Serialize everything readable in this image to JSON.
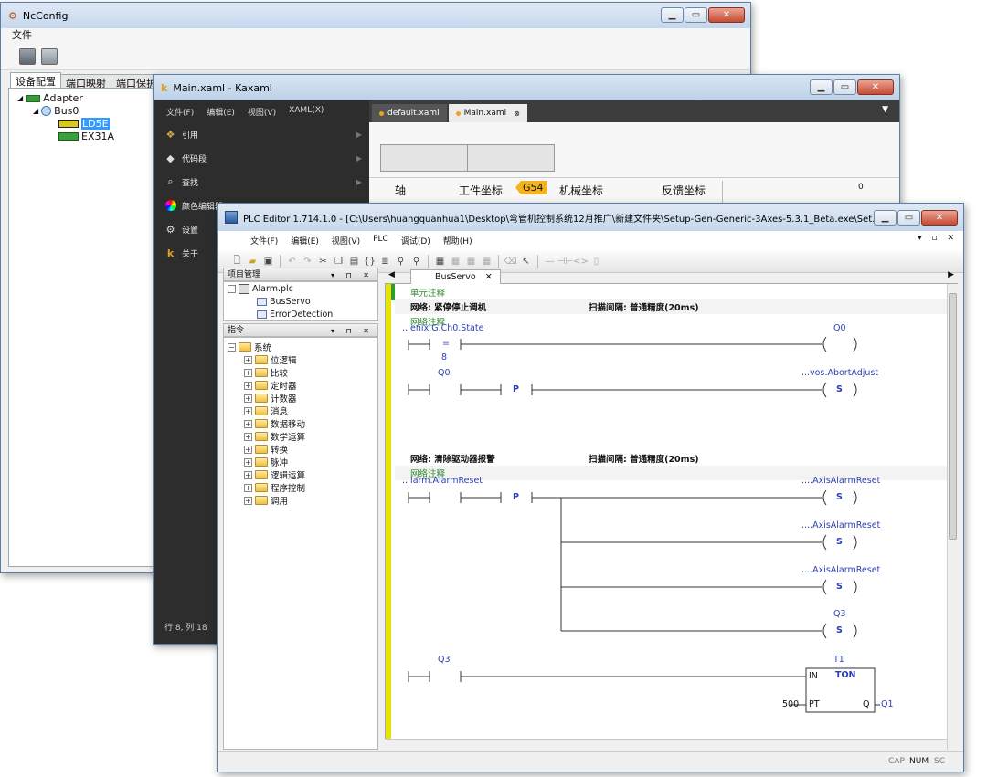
{
  "ncconfig": {
    "title": "NcConfig",
    "menu": "文件",
    "tabs": [
      "设备配置",
      "端口映射",
      "端口保护"
    ],
    "tree": {
      "root": "Adapter",
      "bus": "Bus0",
      "devices": [
        "LD5E",
        "EX31A"
      ]
    }
  },
  "kaxaml": {
    "title": "Main.xaml - Kaxaml",
    "menu": [
      "文件(F)",
      "编辑(E)",
      "视图(V)",
      "XAML(X)"
    ],
    "side_items": [
      "引用",
      "代码段",
      "查找",
      "颜色编辑器",
      "设置",
      "关于"
    ],
    "doc_tabs": [
      "default.xaml",
      "Main.xaml"
    ],
    "status": "行 8, 列 18",
    "preview": {
      "col_axis": "轴",
      "col_work": "工件坐标",
      "badge": "G54",
      "col_machine": "机械坐标",
      "col_feedback": "反馈坐标",
      "value": "0"
    }
  },
  "plc": {
    "title": "PLC Editor 1.714.1.0 - [C:\\Users\\huangquanhua1\\Desktop\\弯管机控制系统12月推广\\新建文件夹\\Setup-Gen-Generic-3Axes-5.3.1_Beta.exe\\Set...",
    "menu": [
      "文件(F)",
      "编辑(E)",
      "视图(V)",
      "PLC",
      "调试(D)",
      "帮助(H)"
    ],
    "project_pane": {
      "title": "项目管理",
      "file": "Alarm.plc",
      "items": [
        "BusServo",
        "ErrorDetection"
      ]
    },
    "instr_pane": {
      "title": "指令",
      "root": "系统",
      "folders": [
        "位逻辑",
        "比较",
        "定时器",
        "计数器",
        "消息",
        "数据移动",
        "数学运算",
        "转换",
        "脉冲",
        "逻辑运算",
        "程序控制",
        "调用"
      ]
    },
    "editor_tab": "BusServo",
    "ladder": {
      "unit_comment": "单元注释",
      "net1": {
        "label": "网络: 紧停停止调机",
        "scan": "扫描间隔: 普通精度(20ms)",
        "comment": "网络注释"
      },
      "net2": {
        "label": "网络: 清除驱动器报警",
        "scan": "扫描间隔: 普通精度(20ms)",
        "comment": "网络注释"
      },
      "r1_var": "...enix.G.Ch0.State",
      "r1_cmp": "=",
      "r1_val": "8",
      "r1_coil": "Q0",
      "r2_contact": "Q0",
      "r2_coil": "...vos.AbortAdjust",
      "r3_var": "...larm.AlarmReset",
      "r3_coil1": "....AxisAlarmReset",
      "r3_coil2": "....AxisAlarmReset",
      "r3_coil3": "....AxisAlarmReset",
      "r3_coil4": "Q3",
      "r4_contact": "Q3",
      "timer_name": "T1",
      "timer_type": "TON",
      "timer_in": "IN",
      "timer_pt_label": "PT",
      "timer_pt_val": "500",
      "timer_q": "Q",
      "timer_out": "Q1",
      "p_label": "P",
      "s_label": "S"
    },
    "status": {
      "cap": "CAP",
      "num": "NUM",
      "scrl": "SC"
    }
  }
}
